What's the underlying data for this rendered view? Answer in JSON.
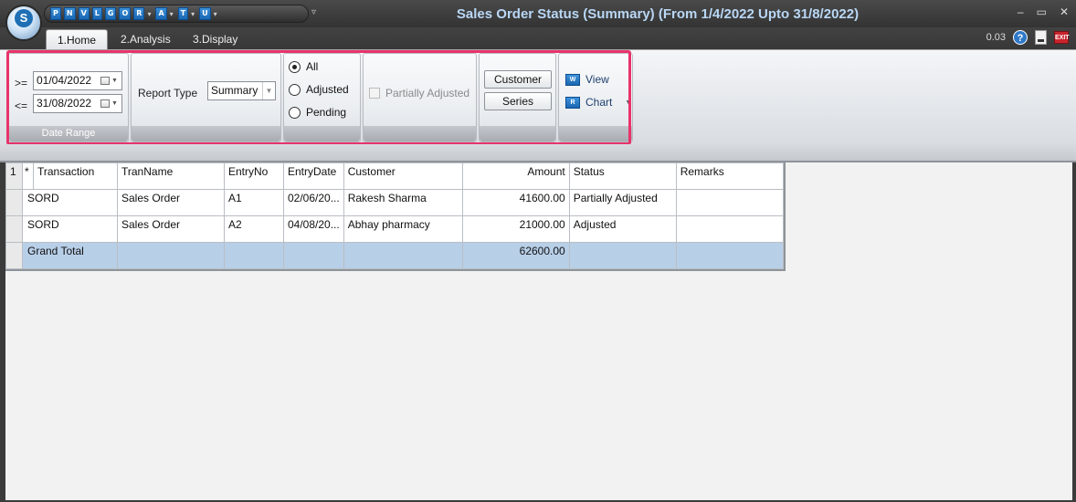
{
  "window": {
    "title": "Sales Order Status (Summary)  (From 1/4/2022 Upto 31/8/2022)",
    "logo_letter": "S"
  },
  "qat": {
    "buttons": [
      "P",
      "N",
      "V",
      "L",
      "G",
      "O",
      "R",
      "A",
      "T",
      "U"
    ]
  },
  "tabs": [
    {
      "label": "1.Home"
    },
    {
      "label": "2.Analysis"
    },
    {
      "label": "3.Display"
    }
  ],
  "tools": {
    "zoom": "0.03",
    "help": "?",
    "exit": "EXIT"
  },
  "ribbon": {
    "date_range": {
      "ge_label": ">=",
      "le_label": "<=",
      "from_value": "01/04/2022",
      "to_value": "31/08/2022",
      "caption": "Date Range"
    },
    "report_type": {
      "label": "Report Type",
      "value": "Summary"
    },
    "filter": {
      "options": [
        "All",
        "Adjusted",
        "Pending"
      ],
      "selected": "All"
    },
    "partial": {
      "label": "Partially Adjusted"
    },
    "buttons": {
      "customer": "Customer",
      "series": "Series"
    },
    "view": {
      "view_label": "View",
      "chart_label": "Chart",
      "view_icon": "W",
      "chart_icon": "R"
    }
  },
  "grid": {
    "corner": [
      "1",
      "*"
    ],
    "columns": [
      "Transaction",
      "TranName",
      "EntryNo",
      "EntryDate",
      "Customer",
      "Amount",
      "Status",
      "Remarks"
    ],
    "rows": [
      {
        "transaction": "SORD",
        "tranname": "Sales Order",
        "entryno": "A1",
        "entrydate": "02/06/20...",
        "customer": "Rakesh Sharma",
        "amount": "41600.00",
        "status": "Partially Adjusted",
        "remarks": ""
      },
      {
        "transaction": "SORD",
        "tranname": "Sales Order",
        "entryno": "A2",
        "entrydate": "04/08/20...",
        "customer": "Abhay pharmacy",
        "amount": "21000.00",
        "status": "Adjusted",
        "remarks": ""
      }
    ],
    "total": {
      "label": "Grand Total",
      "amount": "62600.00"
    }
  }
}
